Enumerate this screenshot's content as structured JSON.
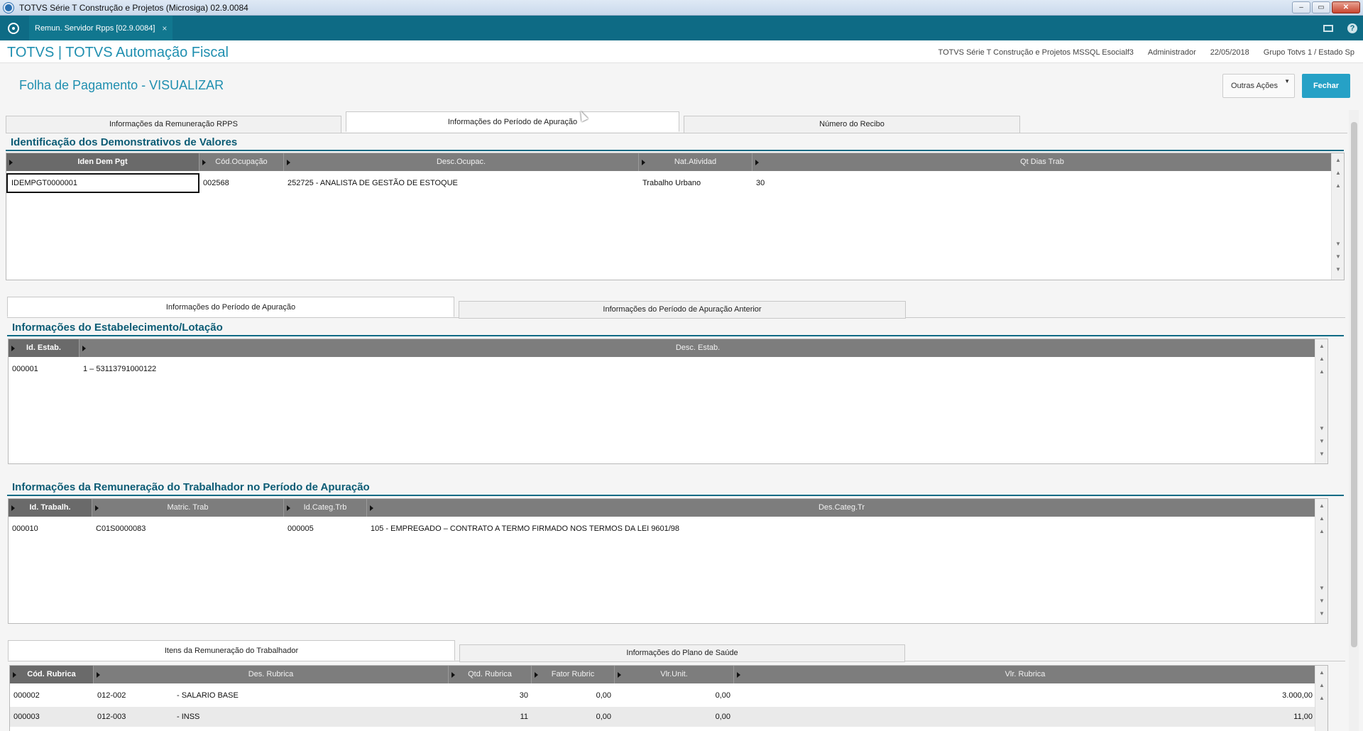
{
  "window": {
    "title": "TOTVS Série T Construção e Projetos (Microsiga) 02.9.0084",
    "controls": {
      "minimize": "–",
      "maximize": "▭",
      "close": "✕"
    }
  },
  "tabbar": {
    "open_tab": "Remun. Servidor Rpps [02.9.0084]",
    "close_symbol": "×",
    "help_symbol": "?"
  },
  "header": {
    "brand": "TOTVS | TOTVS Automação Fiscal",
    "environment": "TOTVS Série T Construção e Projetos MSSQL Esocialf3",
    "user": "Administrador",
    "date": "22/05/2018",
    "company": "Grupo Totvs 1 / Estado Sp"
  },
  "form": {
    "title": "Folha de Pagamento - VISUALIZAR",
    "other_actions": "Outras Ações",
    "close": "Fechar"
  },
  "top_tabs": [
    "Informações da Remuneração RPPS",
    "Informações do Período de Apuração",
    "Número do Recibo"
  ],
  "section1": {
    "title": "Identificação dos Demonstrativos de Valores",
    "columns": [
      "Iden Dem Pgt",
      "Cód.Ocupação",
      "Desc.Ocupac.",
      "Nat.Atividad",
      "Qt Dias Trab"
    ],
    "rows": [
      [
        "IDEMPGT0000001",
        "002568",
        "252725 - ANALISTA DE GESTÃO DE ESTOQUE",
        "Trabalho Urbano",
        "30"
      ]
    ]
  },
  "mid_tabs": [
    "Informações do Período de Apuração",
    "Informações do Período de Apuração Anterior"
  ],
  "section2": {
    "title": "Informações do Estabelecimento/Lotação",
    "columns": [
      "Id. Estab.",
      "Desc. Estab."
    ],
    "rows": [
      [
        "000001",
        "1 – 53113791000122"
      ]
    ]
  },
  "section3": {
    "title": "Informações da Remuneração do Trabalhador no Período de Apuração",
    "columns": [
      "Id. Trabalh.",
      "Matric. Trab",
      "Id.Categ.Trb",
      "Des.Categ.Tr"
    ],
    "rows": [
      [
        "000010",
        "C01S0000083",
        "000005",
        "105 - EMPREGADO – CONTRATO A TERMO FIRMADO NOS TERMOS DA LEI 9601/98"
      ]
    ]
  },
  "bottom_tabs": [
    "Itens da Remuneração do Trabalhador",
    "Informações do Plano de Saúde"
  ],
  "section4": {
    "columns": [
      "Cód. Rubrica",
      "Des. Rubrica",
      "Qtd. Rubrica",
      "Fator Rubric",
      "Vlr.Unit.",
      "Vlr. Rubrica"
    ],
    "rows": [
      [
        "000002",
        "012-002",
        "- SALARIO BASE",
        "30",
        "0,00",
        "0,00",
        "3.000,00"
      ],
      [
        "000003",
        "012-003",
        "- INSS",
        "11",
        "0,00",
        "0,00",
        "11,00"
      ]
    ]
  }
}
